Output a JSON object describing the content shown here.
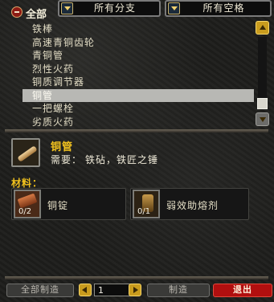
{
  "header": {
    "all_label": "全部",
    "subclass_filter": "所有分支",
    "slot_filter": "所有空格"
  },
  "recipes": [
    {
      "name": "铁棒"
    },
    {
      "name": "高速青铜齿轮"
    },
    {
      "name": "青铜管"
    },
    {
      "name": "烈性火药"
    },
    {
      "name": "铜质调节器"
    },
    {
      "name": "铜管",
      "selected": true
    },
    {
      "name": "一把螺栓"
    },
    {
      "name": "劣质火药"
    }
  ],
  "detail": {
    "name": "铜管",
    "requires_label": "需要：",
    "requires_tools": "铁砧，铁匠之锤",
    "materials_label": "材料：",
    "reagents": [
      {
        "name": "铜锭",
        "count": "0/2"
      },
      {
        "name": "弱效助熔剂",
        "count": "0/1"
      }
    ]
  },
  "footer": {
    "create_all": "全部制造",
    "quantity": "1",
    "create": "制造",
    "exit": "退出"
  },
  "colors": {
    "title_gold": "#f2c21e",
    "exit_red": "#b10f0f",
    "selection": "#b8b8b4"
  }
}
